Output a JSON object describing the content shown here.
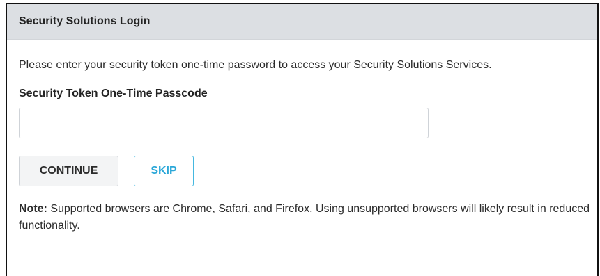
{
  "header": {
    "title": "Security Solutions Login"
  },
  "body": {
    "intro": "Please enter your security token one-time password to access your Security Solutions Services.",
    "field_label": "Security Token One-Time Passcode",
    "input_value": "",
    "input_placeholder": "",
    "continue_label": "CONTINUE",
    "skip_label": "SKIP",
    "note_label": "Note:",
    "note_text": " Supported browsers are Chrome, Safari, and Firefox. Using unsupported browsers will likely result in reduced functionality."
  },
  "colors": {
    "header_bg": "#dcdfe3",
    "skip_accent": "#2aa7d8",
    "border": "#cfd3d8"
  }
}
